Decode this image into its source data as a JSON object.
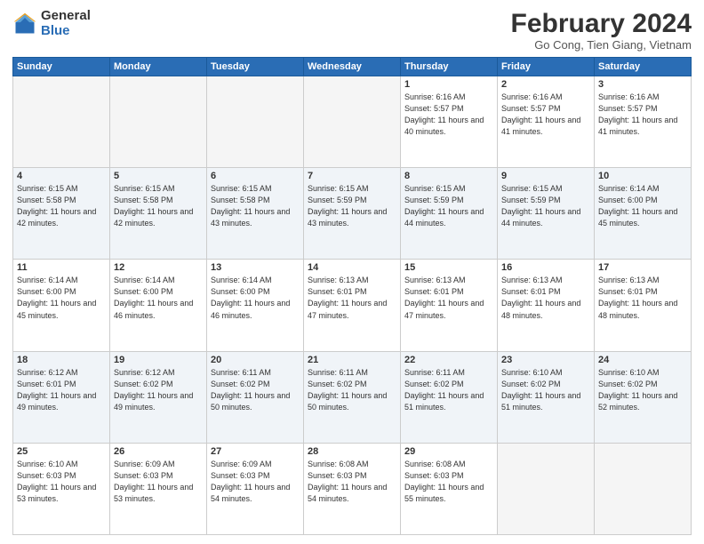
{
  "logo": {
    "general": "General",
    "blue": "Blue"
  },
  "header": {
    "title": "February 2024",
    "subtitle": "Go Cong, Tien Giang, Vietnam"
  },
  "weekdays": [
    "Sunday",
    "Monday",
    "Tuesday",
    "Wednesday",
    "Thursday",
    "Friday",
    "Saturday"
  ],
  "weeks": [
    [
      {
        "day": "",
        "sunrise": "",
        "sunset": "",
        "daylight": ""
      },
      {
        "day": "",
        "sunrise": "",
        "sunset": "",
        "daylight": ""
      },
      {
        "day": "",
        "sunrise": "",
        "sunset": "",
        "daylight": ""
      },
      {
        "day": "",
        "sunrise": "",
        "sunset": "",
        "daylight": ""
      },
      {
        "day": "1",
        "sunrise": "Sunrise: 6:16 AM",
        "sunset": "Sunset: 5:57 PM",
        "daylight": "Daylight: 11 hours and 40 minutes."
      },
      {
        "day": "2",
        "sunrise": "Sunrise: 6:16 AM",
        "sunset": "Sunset: 5:57 PM",
        "daylight": "Daylight: 11 hours and 41 minutes."
      },
      {
        "day": "3",
        "sunrise": "Sunrise: 6:16 AM",
        "sunset": "Sunset: 5:57 PM",
        "daylight": "Daylight: 11 hours and 41 minutes."
      }
    ],
    [
      {
        "day": "4",
        "sunrise": "Sunrise: 6:15 AM",
        "sunset": "Sunset: 5:58 PM",
        "daylight": "Daylight: 11 hours and 42 minutes."
      },
      {
        "day": "5",
        "sunrise": "Sunrise: 6:15 AM",
        "sunset": "Sunset: 5:58 PM",
        "daylight": "Daylight: 11 hours and 42 minutes."
      },
      {
        "day": "6",
        "sunrise": "Sunrise: 6:15 AM",
        "sunset": "Sunset: 5:58 PM",
        "daylight": "Daylight: 11 hours and 43 minutes."
      },
      {
        "day": "7",
        "sunrise": "Sunrise: 6:15 AM",
        "sunset": "Sunset: 5:59 PM",
        "daylight": "Daylight: 11 hours and 43 minutes."
      },
      {
        "day": "8",
        "sunrise": "Sunrise: 6:15 AM",
        "sunset": "Sunset: 5:59 PM",
        "daylight": "Daylight: 11 hours and 44 minutes."
      },
      {
        "day": "9",
        "sunrise": "Sunrise: 6:15 AM",
        "sunset": "Sunset: 5:59 PM",
        "daylight": "Daylight: 11 hours and 44 minutes."
      },
      {
        "day": "10",
        "sunrise": "Sunrise: 6:14 AM",
        "sunset": "Sunset: 6:00 PM",
        "daylight": "Daylight: 11 hours and 45 minutes."
      }
    ],
    [
      {
        "day": "11",
        "sunrise": "Sunrise: 6:14 AM",
        "sunset": "Sunset: 6:00 PM",
        "daylight": "Daylight: 11 hours and 45 minutes."
      },
      {
        "day": "12",
        "sunrise": "Sunrise: 6:14 AM",
        "sunset": "Sunset: 6:00 PM",
        "daylight": "Daylight: 11 hours and 46 minutes."
      },
      {
        "day": "13",
        "sunrise": "Sunrise: 6:14 AM",
        "sunset": "Sunset: 6:00 PM",
        "daylight": "Daylight: 11 hours and 46 minutes."
      },
      {
        "day": "14",
        "sunrise": "Sunrise: 6:13 AM",
        "sunset": "Sunset: 6:01 PM",
        "daylight": "Daylight: 11 hours and 47 minutes."
      },
      {
        "day": "15",
        "sunrise": "Sunrise: 6:13 AM",
        "sunset": "Sunset: 6:01 PM",
        "daylight": "Daylight: 11 hours and 47 minutes."
      },
      {
        "day": "16",
        "sunrise": "Sunrise: 6:13 AM",
        "sunset": "Sunset: 6:01 PM",
        "daylight": "Daylight: 11 hours and 48 minutes."
      },
      {
        "day": "17",
        "sunrise": "Sunrise: 6:13 AM",
        "sunset": "Sunset: 6:01 PM",
        "daylight": "Daylight: 11 hours and 48 minutes."
      }
    ],
    [
      {
        "day": "18",
        "sunrise": "Sunrise: 6:12 AM",
        "sunset": "Sunset: 6:01 PM",
        "daylight": "Daylight: 11 hours and 49 minutes."
      },
      {
        "day": "19",
        "sunrise": "Sunrise: 6:12 AM",
        "sunset": "Sunset: 6:02 PM",
        "daylight": "Daylight: 11 hours and 49 minutes."
      },
      {
        "day": "20",
        "sunrise": "Sunrise: 6:11 AM",
        "sunset": "Sunset: 6:02 PM",
        "daylight": "Daylight: 11 hours and 50 minutes."
      },
      {
        "day": "21",
        "sunrise": "Sunrise: 6:11 AM",
        "sunset": "Sunset: 6:02 PM",
        "daylight": "Daylight: 11 hours and 50 minutes."
      },
      {
        "day": "22",
        "sunrise": "Sunrise: 6:11 AM",
        "sunset": "Sunset: 6:02 PM",
        "daylight": "Daylight: 11 hours and 51 minutes."
      },
      {
        "day": "23",
        "sunrise": "Sunrise: 6:10 AM",
        "sunset": "Sunset: 6:02 PM",
        "daylight": "Daylight: 11 hours and 51 minutes."
      },
      {
        "day": "24",
        "sunrise": "Sunrise: 6:10 AM",
        "sunset": "Sunset: 6:02 PM",
        "daylight": "Daylight: 11 hours and 52 minutes."
      }
    ],
    [
      {
        "day": "25",
        "sunrise": "Sunrise: 6:10 AM",
        "sunset": "Sunset: 6:03 PM",
        "daylight": "Daylight: 11 hours and 53 minutes."
      },
      {
        "day": "26",
        "sunrise": "Sunrise: 6:09 AM",
        "sunset": "Sunset: 6:03 PM",
        "daylight": "Daylight: 11 hours and 53 minutes."
      },
      {
        "day": "27",
        "sunrise": "Sunrise: 6:09 AM",
        "sunset": "Sunset: 6:03 PM",
        "daylight": "Daylight: 11 hours and 54 minutes."
      },
      {
        "day": "28",
        "sunrise": "Sunrise: 6:08 AM",
        "sunset": "Sunset: 6:03 PM",
        "daylight": "Daylight: 11 hours and 54 minutes."
      },
      {
        "day": "29",
        "sunrise": "Sunrise: 6:08 AM",
        "sunset": "Sunset: 6:03 PM",
        "daylight": "Daylight: 11 hours and 55 minutes."
      },
      {
        "day": "",
        "sunrise": "",
        "sunset": "",
        "daylight": ""
      },
      {
        "day": "",
        "sunrise": "",
        "sunset": "",
        "daylight": ""
      }
    ]
  ]
}
